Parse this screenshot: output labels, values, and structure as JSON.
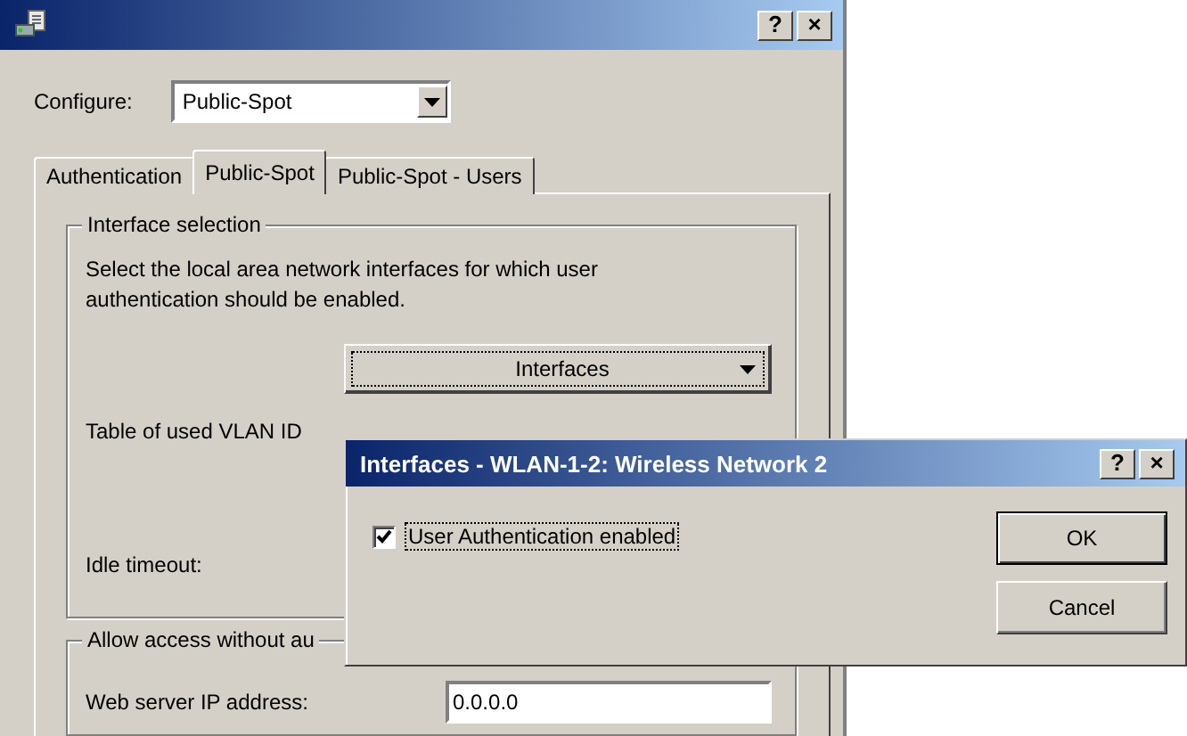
{
  "window": {
    "title_buttons": [
      "?",
      "×"
    ]
  },
  "configure": {
    "label": "Configure:",
    "value": "Public-Spot"
  },
  "tabs": [
    {
      "label": "Authentication",
      "selected": false
    },
    {
      "label": "Public-Spot",
      "selected": true
    },
    {
      "label": "Public-Spot - Users",
      "selected": false
    }
  ],
  "interface_group": {
    "title": "Interface selection",
    "description": "Select the local area network interfaces for which user authentication should be enabled.",
    "button": "Interfaces",
    "vlan_label": "Table of used VLAN ID",
    "idle_label": "Idle timeout:"
  },
  "access_group": {
    "title": "Allow access without au",
    "ip_label": "Web server IP address:",
    "ip_value": "0.0.0.0"
  },
  "dialog": {
    "title": "Interfaces - WLAN-1-2: Wireless Network 2",
    "title_buttons": [
      "?",
      "×"
    ],
    "checkbox": {
      "label": "User Authentication enabled",
      "checked": true
    },
    "buttons": [
      "OK",
      "Cancel"
    ]
  }
}
